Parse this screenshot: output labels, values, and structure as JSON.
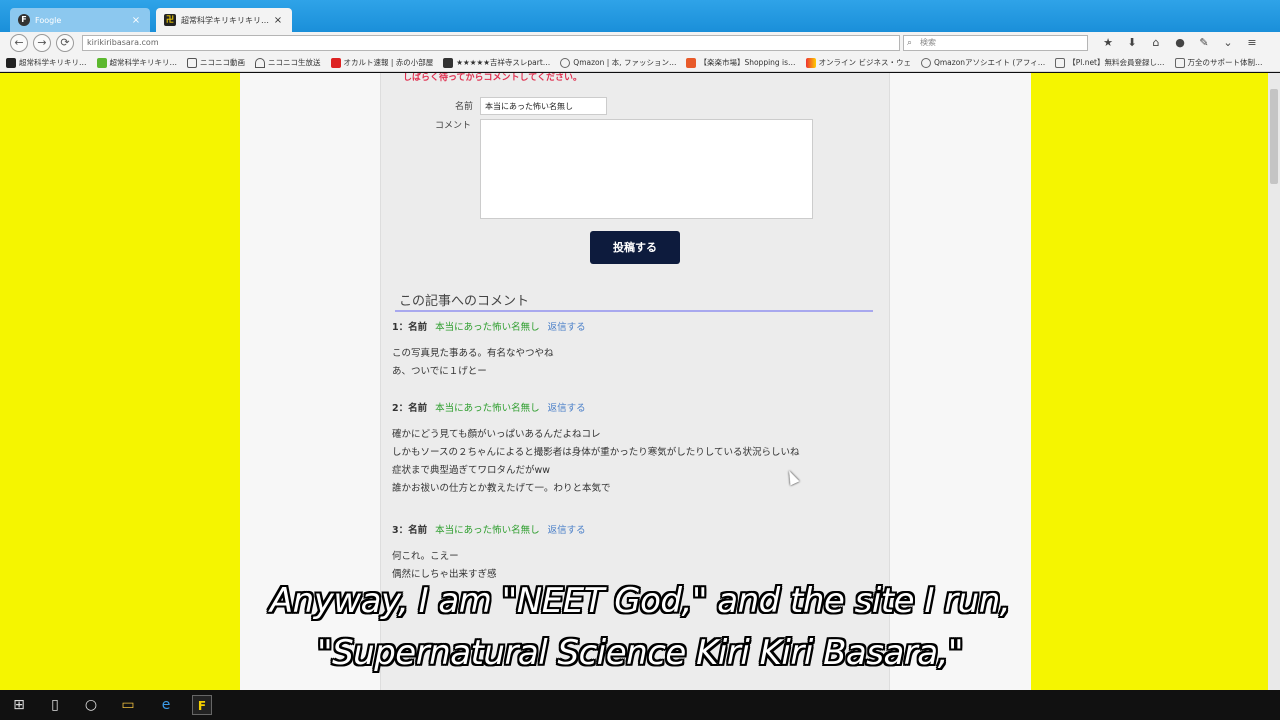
{
  "browser": {
    "tabs": [
      {
        "label": "Foogle",
        "close": "×"
      },
      {
        "label": "超常科学キリキリキリ…",
        "close": "×"
      }
    ],
    "url": "kirikiribasara.com",
    "search_placeholder": "検索",
    "nav": {
      "back": "←",
      "forward": "→",
      "reload": "⟳"
    },
    "bookmarks": [
      "超常科学キリキリ…",
      "超常科学キリキリ…",
      "ニコニコ動画",
      "ニコニコ生放送",
      "オカルト速報 | 赤の小部屋",
      "★★★★★吉祥寺スレpart…",
      "Qmazon | 本, ファッション…",
      "【楽楽市場】Shopping is…",
      "オンライン ビジネス・ウェ",
      "Qmazonアソシエイト (アフィ…",
      "【Pl.net】無料会員登録し…",
      "万全のサポート体制…"
    ]
  },
  "form": {
    "notice_line": "しばらく待ってからコメントしてください。",
    "name_label": "名前",
    "name_value": "本当にあった怖い名無し",
    "comment_label": "コメント",
    "submit_label": "投稿する"
  },
  "comments_section": {
    "heading": "この記事へのコメント",
    "comments": [
      {
        "num": "1：名前",
        "name": "本当にあった怖い名無し",
        "reply": "返信する",
        "lines": [
          "この写真見た事ある。有名なやつやね",
          "あ、ついでに１げとー"
        ]
      },
      {
        "num": "2：名前",
        "name": "本当にあった怖い名無し",
        "reply": "返信する",
        "lines": [
          "確かにどう見ても顔がいっぱいあるんだよねコレ",
          "しかもソースの２ちゃんによると撮影者は身体が重かったり寒気がしたりしている状況らしいね",
          "症状まで典型過ぎてワロタんだがww",
          "誰かお祓いの仕方とか教えたげて一。わりと本気で"
        ]
      },
      {
        "num": "3：名前",
        "name": "本当にあった怖い名無し",
        "reply": "返信する",
        "lines": [
          "何これ。こえー",
          "偶然にしちゃ出来すぎ感"
        ]
      }
    ]
  },
  "subtitles": {
    "line1": "Anyway, I am \"NEET God,\" and the site I run,",
    "line2": "\"Supernatural Science Kiri Kiri Basara,\""
  },
  "colors": {
    "page_background": "#f5f500",
    "accent_red": "#e03050",
    "name_green": "#2e9e2e",
    "reply_blue": "#4a7fc8",
    "submit_navy": "#0d1b3d"
  }
}
